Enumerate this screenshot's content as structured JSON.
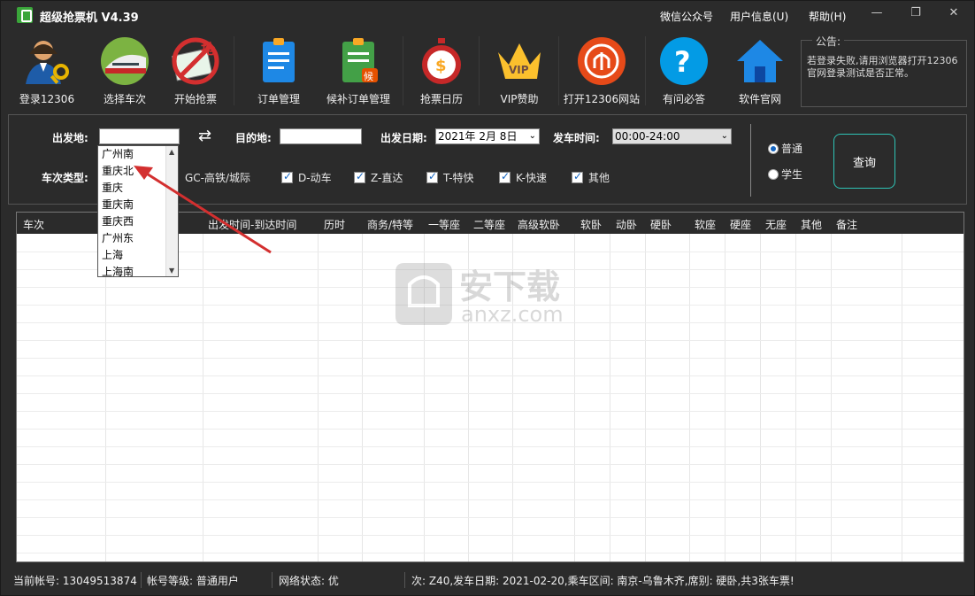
{
  "app": {
    "title": "超级抢票机 V4.39"
  },
  "menu": {
    "wechat": "微信公众号",
    "user_info": "用户信息(U)",
    "help": "帮助(H)"
  },
  "toolbar": [
    {
      "label": "登录12306",
      "icon": "login-user-key-icon"
    },
    {
      "label": "选择车次",
      "icon": "train-icon"
    },
    {
      "label": "开始抢票",
      "icon": "grab-ticket-icon"
    },
    {
      "label": "订单管理",
      "icon": "order-document-icon"
    },
    {
      "label": "候补订单管理",
      "icon": "waitlist-document-icon"
    },
    {
      "label": "抢票日历",
      "icon": "stopwatch-icon"
    },
    {
      "label": "VIP赞助",
      "icon": "vip-crown-icon"
    },
    {
      "label": "打开12306网站",
      "icon": "railway-logo-icon"
    },
    {
      "label": "有问必答",
      "icon": "question-icon"
    },
    {
      "label": "软件官网",
      "icon": "home-icon"
    }
  ],
  "notice": {
    "title": "公告:",
    "body": "若登录失败,请用浏览器打开12306官网登录测试是否正常。"
  },
  "query": {
    "from_label": "出发地:",
    "from_value": "",
    "swap_icon": "swap-arrows-icon",
    "to_label": "目的地:",
    "to_value": "",
    "date_label": "出发日期:",
    "date_value": "2021年 2月 8日",
    "time_label": "发车时间:",
    "time_value": "00:00-24:00",
    "train_type_label": "车次类型:",
    "train_types": [
      {
        "label": "GC-高铁/城际",
        "checked": true
      },
      {
        "label": "D-动车",
        "checked": true
      },
      {
        "label": "Z-直达",
        "checked": true
      },
      {
        "label": "T-特快",
        "checked": true
      },
      {
        "label": "K-快速",
        "checked": true
      },
      {
        "label": "其他",
        "checked": true
      }
    ],
    "passenger": [
      {
        "label": "普通",
        "selected": true
      },
      {
        "label": "学生",
        "selected": false
      }
    ],
    "search_button": "查询"
  },
  "station_dropdown": [
    "广州南",
    "重庆北",
    "重庆",
    "重庆南",
    "重庆西",
    "广州东",
    "上海",
    "上海南"
  ],
  "table": {
    "columns": [
      "车次",
      "出发时间-到达时间",
      "历时",
      "商务/特等",
      "一等座",
      "二等座",
      "高级软卧",
      "软卧",
      "动卧",
      "硬卧",
      "软座",
      "硬座",
      "无座",
      "其他",
      "备注"
    ]
  },
  "watermark": {
    "text_cn": "安下载",
    "text_en": "anxz.com"
  },
  "status": {
    "account": "当前帐号: 13049513874",
    "level": "帐号等级: 普通用户",
    "network": "网络状态: 优",
    "message": "次: Z40,发车日期: 2021-02-20,乘车区间: 南京-乌鲁木齐,席别: 硬卧,共3张车票!"
  },
  "colors": {
    "bg": "#2b2b2b",
    "accent": "#2ec4b6",
    "arrow": "#d32f2f"
  }
}
